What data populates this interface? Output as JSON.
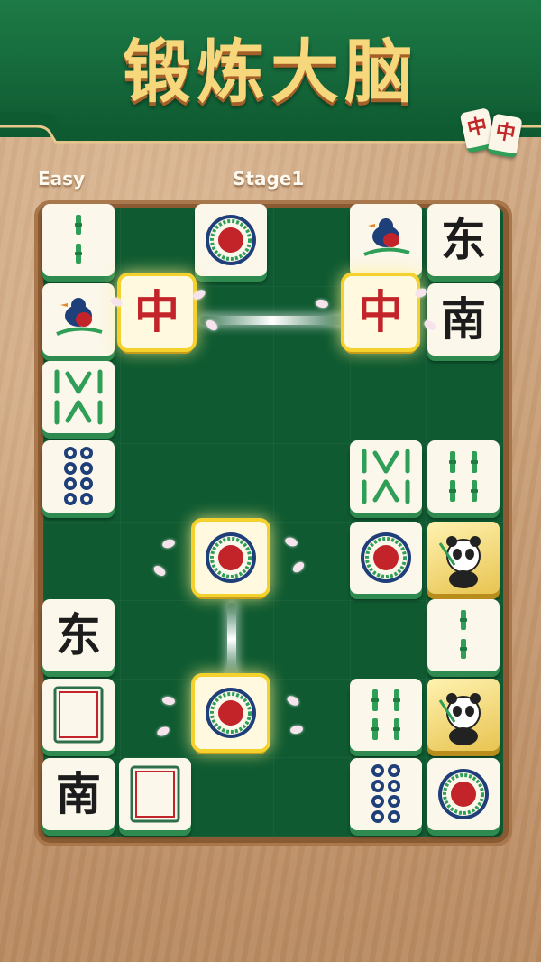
{
  "header": {
    "title": "锻炼大脑",
    "deco_glyph": "中"
  },
  "status": {
    "difficulty": "Easy",
    "stage": "Stage1"
  },
  "colors": {
    "banner": "#137245",
    "board": "#0f5a31",
    "tile_face": "#fbf7ea",
    "tile_edge": "#2e8a4f",
    "highlight": "#f4d12c",
    "red": "#c2242a"
  },
  "tiles": [
    {
      "kind": "bamboo-1",
      "icon": "bamboo-one-icon"
    },
    {
      "kind": "dot-1",
      "icon": "circle-one-icon"
    },
    {
      "kind": "bird",
      "icon": "bird-icon"
    },
    {
      "kind": "char",
      "text": "东"
    },
    {
      "kind": "bird",
      "icon": "bird-icon"
    },
    {
      "kind": "char",
      "text": "中",
      "selected": true
    },
    {
      "kind": "char",
      "text": "中",
      "selected": true
    },
    {
      "kind": "char",
      "text": "南"
    },
    {
      "kind": "bamboo-8",
      "icon": "bamboo-eight-icon"
    },
    {
      "kind": "dot-8",
      "icon": "circles-eight-icon"
    },
    {
      "kind": "bamboo-8",
      "icon": "bamboo-eight-icon"
    },
    {
      "kind": "bamboo-4",
      "icon": "bamboo-four-icon"
    },
    {
      "kind": "dot-1",
      "icon": "circle-one-icon",
      "selected": true
    },
    {
      "kind": "dot-1",
      "icon": "circle-one-icon"
    },
    {
      "kind": "panda",
      "icon": "panda-icon"
    },
    {
      "kind": "char",
      "text": "东"
    },
    {
      "kind": "bamboo-1",
      "icon": "bamboo-one-icon"
    },
    {
      "kind": "white-dragon",
      "icon": "white-dragon-icon"
    },
    {
      "kind": "dot-1",
      "icon": "circle-one-icon",
      "selected": true
    },
    {
      "kind": "bamboo-4",
      "icon": "bamboo-four-icon"
    },
    {
      "kind": "panda",
      "icon": "panda-icon"
    },
    {
      "kind": "char",
      "text": "南"
    },
    {
      "kind": "white-dragon",
      "icon": "white-dragon-icon"
    },
    {
      "kind": "dot-8",
      "icon": "circles-eight-icon"
    },
    {
      "kind": "dot-1",
      "icon": "circle-one-icon"
    }
  ]
}
